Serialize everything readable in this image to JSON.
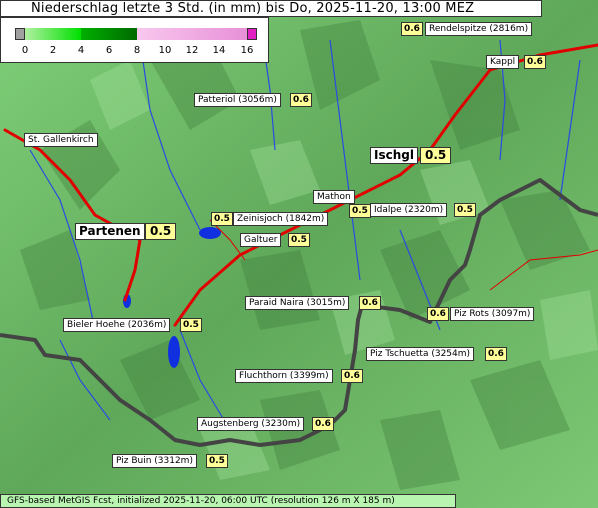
{
  "title": "Niederschlag letzte 3 Std. (in mm) bis Do, 2025-11-20, 13:00 MEZ",
  "legend": {
    "ticks": [
      "0",
      "2",
      "4",
      "6",
      "8",
      "10",
      "12",
      "14",
      "16"
    ],
    "colors": {
      "zero": "#a0a0a0",
      "low": "#00e000",
      "mid": "#008a00",
      "high": "#f4a8e0",
      "max": "#e020c0"
    }
  },
  "places": [
    {
      "id": "rendelspitze",
      "name": "Rendelspitze (2816m)",
      "value": "0.6"
    },
    {
      "id": "kappl",
      "name": "Kappl",
      "value": "0.6"
    },
    {
      "id": "patteriol",
      "name": "Patteriol (3056m)",
      "value": "0.6"
    },
    {
      "id": "st-gallenkirch",
      "name": "St. Gallenkirch",
      "value": ""
    },
    {
      "id": "ischgl",
      "name": "Ischgl",
      "value": "0.5"
    },
    {
      "id": "mathon",
      "name": "Mathon",
      "value": "0.5"
    },
    {
      "id": "idalpe",
      "name": "Idalpe (2320m)",
      "value": "0.5"
    },
    {
      "id": "zeinisjoch",
      "name": "Zeinisjoch (1842m)",
      "value": "0.5"
    },
    {
      "id": "partenen",
      "name": "Partenen",
      "value": "0.5"
    },
    {
      "id": "galtuer",
      "name": "Galtuer",
      "value": "0.5"
    },
    {
      "id": "paraid-naira",
      "name": "Paraid Naira (3015m)",
      "value": "0.6"
    },
    {
      "id": "piz-rots",
      "name": "Piz Rots (3097m)",
      "value": "0.6"
    },
    {
      "id": "bieler-hoehe",
      "name": "Bieler Hoehe (2036m)",
      "value": "0.5"
    },
    {
      "id": "piz-tschuetta",
      "name": "Piz Tschuetta (3254m)",
      "value": "0.6"
    },
    {
      "id": "fluchthorn",
      "name": "Fluchthorn (3399m)",
      "value": "0.6"
    },
    {
      "id": "augstenberg",
      "name": "Augstenberg (3230m)",
      "value": "0.6"
    },
    {
      "id": "piz-buin",
      "name": "Piz Buin (3312m)",
      "value": "0.5"
    }
  ],
  "footer": "GFS-based MetGIS Fcst, initialized 2025-11-20, 06:00 UTC  (resolution 126 m X 185 m)",
  "colors": {
    "terrain": "#6fbf6a",
    "road": "#e00000",
    "border": "#444444",
    "water": "#1030e0",
    "label_value_bg": "#ffff99",
    "footer_bg": "#b8f5b0"
  }
}
